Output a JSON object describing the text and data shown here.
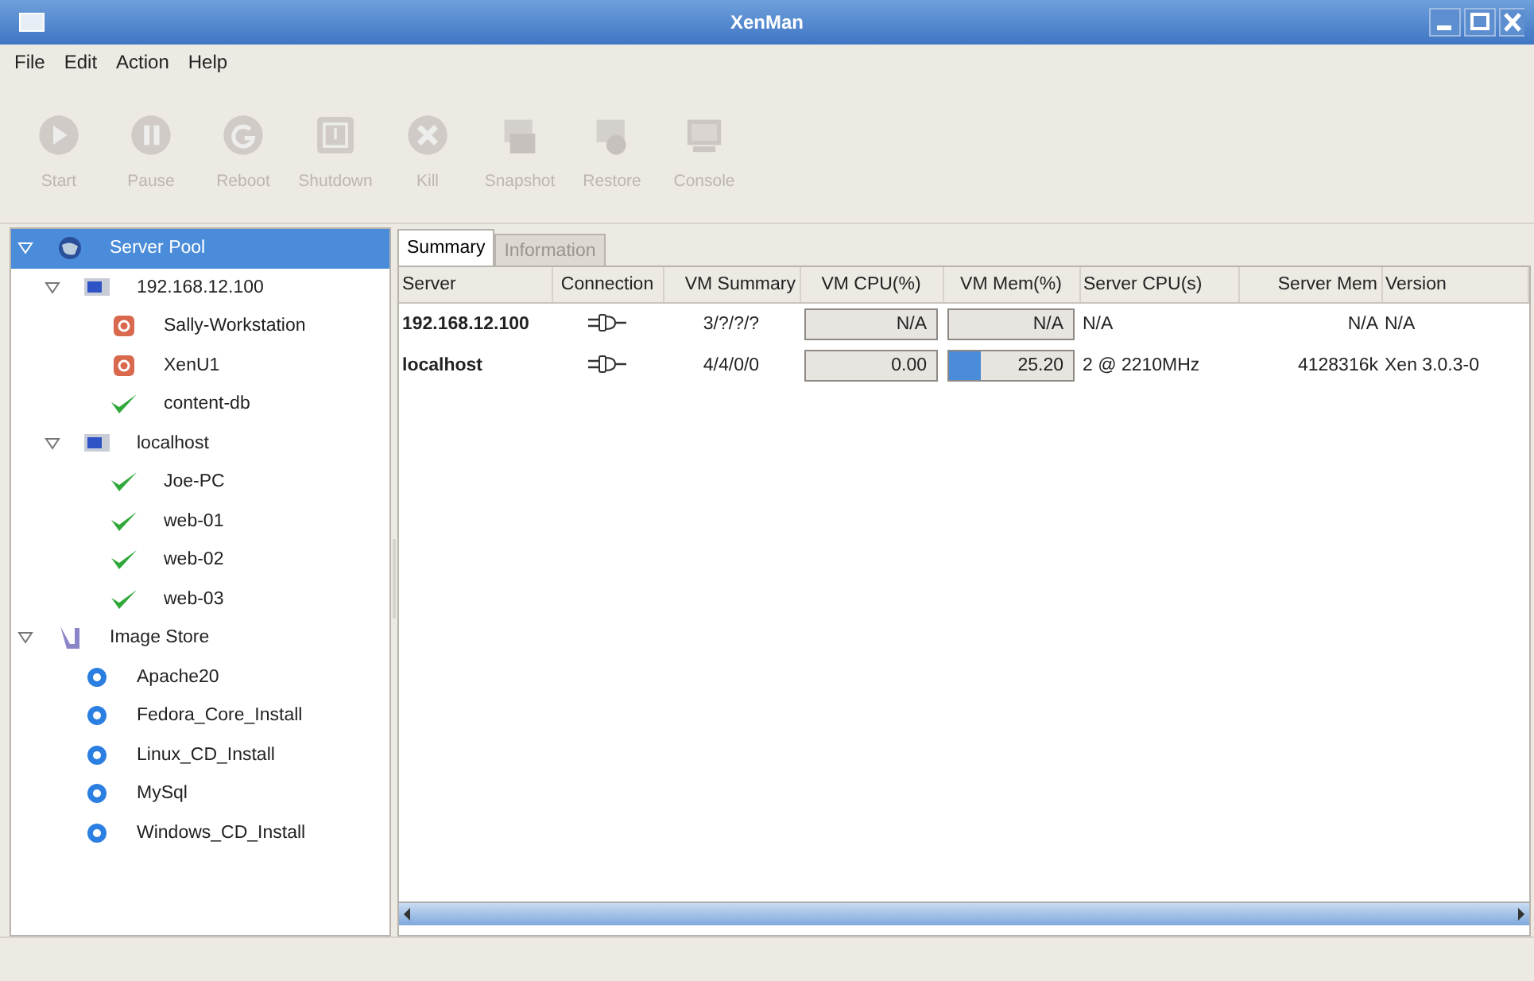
{
  "window": {
    "title": "XenMan"
  },
  "menu": [
    {
      "label": "File"
    },
    {
      "label": "Edit"
    },
    {
      "label": "Action"
    },
    {
      "label": "Help"
    }
  ],
  "toolbar": [
    {
      "kind": "start",
      "label": "Start",
      "disabled": true
    },
    {
      "kind": "pause",
      "label": "Pause",
      "disabled": true
    },
    {
      "kind": "reboot",
      "label": "Reboot",
      "disabled": true
    },
    {
      "kind": "shutdown",
      "label": "Shutdown",
      "disabled": true
    },
    {
      "kind": "kill",
      "label": "Kill",
      "disabled": true
    },
    {
      "kind": "snapshot",
      "label": "Snapshot",
      "disabled": true
    },
    {
      "kind": "restore",
      "label": "Restore",
      "disabled": true
    },
    {
      "kind": "console",
      "label": "Console",
      "disabled": true
    }
  ],
  "tree": [
    {
      "kind": "pool",
      "label": "Server Pool",
      "selected": true,
      "expanded": true,
      "children": [
        {
          "kind": "server",
          "label": "192.168.12.100",
          "selected": false,
          "expanded": true,
          "children": [
            {
              "kind": "stopped",
              "label": "Sally-Workstation",
              "selected": false
            },
            {
              "kind": "stopped",
              "label": "XenU1",
              "selected": false
            },
            {
              "kind": "running",
              "label": "content-db",
              "selected": false
            }
          ]
        },
        {
          "kind": "server",
          "label": "localhost",
          "selected": false,
          "expanded": true,
          "children": [
            {
              "kind": "running",
              "label": "Joe-PC",
              "selected": false
            },
            {
              "kind": "running",
              "label": "web-01",
              "selected": false
            },
            {
              "kind": "running",
              "label": "web-02",
              "selected": false
            },
            {
              "kind": "running",
              "label": "web-03",
              "selected": false
            }
          ]
        }
      ]
    },
    {
      "kind": "store",
      "label": "Image Store",
      "selected": false,
      "expanded": true,
      "children": [
        {
          "kind": "image",
          "label": "Apache20",
          "selected": false
        },
        {
          "kind": "image",
          "label": "Fedora_Core_Install",
          "selected": false
        },
        {
          "kind": "image",
          "label": "Linux_CD_Install",
          "selected": false
        },
        {
          "kind": "image",
          "label": "MySql",
          "selected": false
        },
        {
          "kind": "image",
          "label": "Windows_CD_Install",
          "selected": false
        }
      ]
    }
  ],
  "tabs": [
    {
      "label": "Summary",
      "selected": true,
      "disabled": false
    },
    {
      "label": "Information",
      "selected": false,
      "disabled": true
    }
  ],
  "table": {
    "columns": [
      "Server",
      "Connection",
      "VM Summary",
      "VM CPU(%)",
      "VM Mem(%)",
      "Server CPU(s)",
      "Server Mem",
      "Version"
    ],
    "rows": [
      {
        "server": "192.168.12.100",
        "vm_summary": "3/?/?/?",
        "vm_cpu": {
          "text": "N/A"
        },
        "vm_mem": {
          "text": "N/A"
        },
        "server_cpu": "N/A",
        "server_mem": "N/A",
        "version": "N/A"
      },
      {
        "server": "localhost",
        "vm_summary": "4/4/0/0",
        "vm_cpu": {
          "text": "0.00"
        },
        "vm_mem": {
          "text": "25.20",
          "level": 0.252
        },
        "server_cpu": "2 @ 2210MHz",
        "server_mem": "4128316k",
        "version": "Xen 3.0.3-0"
      }
    ]
  }
}
